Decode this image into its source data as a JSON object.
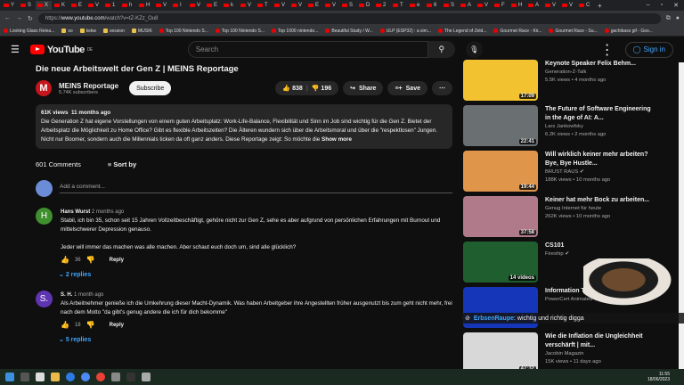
{
  "browser": {
    "tabs": [
      "Y",
      "S",
      "X",
      "K",
      "E",
      "V",
      "1",
      "h",
      "H",
      "V",
      "I",
      "V",
      "E",
      "k",
      "V",
      "T",
      "V",
      "V",
      "E",
      "V",
      "S",
      "D",
      "2",
      "T",
      "e",
      "6",
      "S",
      "A",
      "V",
      "F",
      "H",
      "A",
      "V",
      "V",
      "C"
    ],
    "active_tab": 2,
    "new_tab": "+",
    "url_prefix": "https://",
    "url_host": "www.youtube.com",
    "url_path": "/watch?v=tZ-KZz_Ou8",
    "bookmarks": [
      "Looking Glass Relea...",
      "so",
      "kekw",
      "session",
      "MUSIK",
      "Top 100 Nintendo S...",
      "Top 100 Nintendo S...",
      "Top 1000 nintendo...",
      "Beautiful Study / W...",
      "ULP (ESP32) : a sim...",
      "The Legend of Zeld...",
      "Gourmet Race - Kir...",
      "Gourmet Race - Su...",
      "gachibass gif - Goo..."
    ]
  },
  "header": {
    "logo": "YouTube",
    "region": "DE",
    "search_placeholder": "Search",
    "sign_in": "Sign in"
  },
  "video": {
    "title": "Die neue Arbeitswelt der Gen Z | MEINS Reportage",
    "channel": "MEINS Reportage",
    "channel_initial": "M",
    "subscribers": "5.74K subscribers",
    "subscribe": "Subscribe",
    "likes": "838",
    "dislikes": "196",
    "share": "Share",
    "save": "Save",
    "more": "⋯",
    "views": "61K views",
    "age": "11 months ago",
    "description": "Die Generation Z hat eigene Vorstellungen von einem guten Arbeitsplatz: Work-Life-Balance, Flexibilität und Sinn im Job sind wichtig für die Gen Z. Bietet der Arbeitsplatz die Möglichkeit zu Home Office? Gibt es flexible Arbeitszeiten? Die Älteren wundern sich über die Arbeitsmoral und über die \"respektlosen\" Jungen. Nicht nur Boomer, sondern auch die Millennials ticken da oft ganz anders. Diese Reportage zeigt: So möchte die",
    "show_more": "Show more"
  },
  "comments": {
    "count": "601 Comments",
    "sort": "Sort by",
    "add_placeholder": "Add a comment...",
    "items": [
      {
        "initial": "H",
        "color": "#3f8f2f",
        "author": "Hans Wurst",
        "age": "2 months ago",
        "text": "Stabil, ich bin 35, schon seit 15 Jahren Vollzeitbeschäftigt, gehöre nicht zur Gen Z, sehe es aber aufgrund von persönlichen Erfahrungen mit Burnout und mittelschwerer Depression genauso.",
        "text2": "Jeder will immer das machen was alle machen. Aber schaut euch doch um, sind alle glücklich?",
        "likes": "36",
        "reply": "Reply",
        "replies": "2 replies"
      },
      {
        "initial": "S.",
        "color": "#5e35b1",
        "author": "S. H.",
        "age": "1 month ago",
        "text": "Als Arbeitnehmer genieße ich die Umkehrung dieser Macht-Dynamik. Was haben Arbeitgeber ihre Angestellten früher ausgenutzt bis zum geht nicht mehr, frei nach dem Motto \"da gibt's genug andere die ich für dich bekomme\"",
        "text2": "",
        "likes": "18",
        "reply": "Reply",
        "replies": "5 replies"
      }
    ]
  },
  "sidebar": [
    {
      "title": "Keynote Speaker Felix Behm...",
      "channel": "Generation-Z-Talk",
      "meta": "5.5K views • 4 months ago",
      "duration": "17:09",
      "thumb": "#f2c230"
    },
    {
      "title": "The Future of Software Engineering in the Age of AI: A...",
      "channel": "Lars Jankowfsky",
      "meta": "6.2K views • 2 months ago",
      "duration": "22:41",
      "thumb": "#6a6f72"
    },
    {
      "title": "Will wirklich keiner mehr arbeiten? Bye, Bye Hustle...",
      "channel": "BRUST RAUS ✔",
      "meta": "188K views • 10 months ago",
      "duration": "19:44",
      "thumb": "#e0964a"
    },
    {
      "title": "Keiner hat mehr Bock zu arbeiten...",
      "channel": "Genug Internet für heute",
      "meta": "262K views • 10 months ago",
      "duration": "37:58",
      "thumb": "#b07a8a"
    },
    {
      "title": "CS101",
      "channel": "Fireship ✔",
      "meta": "",
      "duration": "14 videos",
      "thumb": "#1f5e2e"
    },
    {
      "title": "Information Technology",
      "channel": "PowerCert Animated Videos ✔",
      "meta": "",
      "duration": "",
      "thumb": "#1536b8"
    },
    {
      "title": "Wie die Inflation die Ungleichheit verschärft | mit...",
      "channel": "Jacobin Magazin",
      "meta": "15K views • 11 days ago",
      "duration": "47:32",
      "thumb": "#d8d8d8"
    }
  ],
  "overlay": {
    "chat_user": "ErbsenRaupe",
    "chat_msg": ": wichtig und richtig digga"
  },
  "taskbar": {
    "time": "11:55",
    "date": "18/06/2023"
  }
}
